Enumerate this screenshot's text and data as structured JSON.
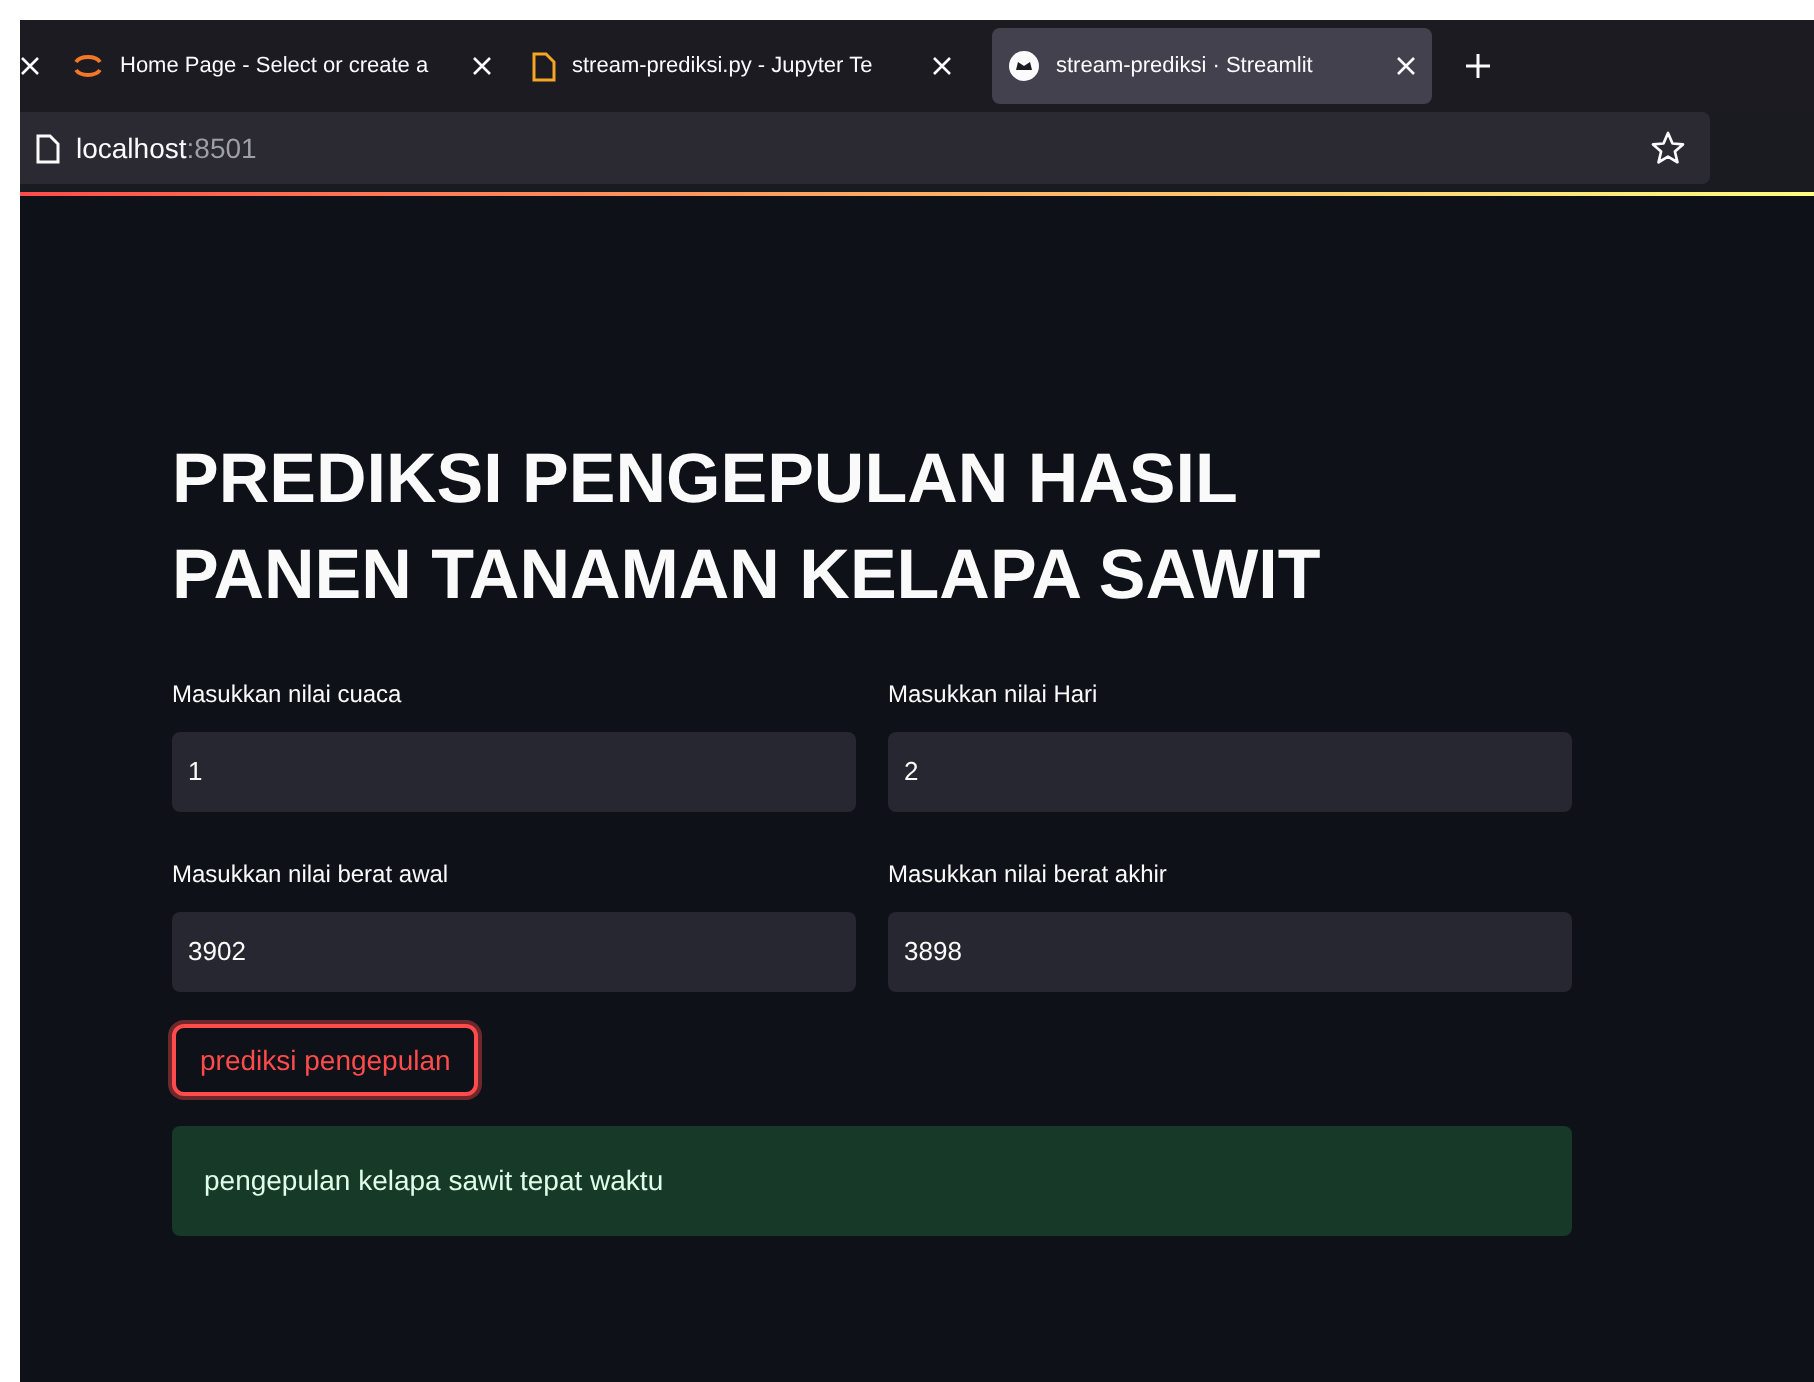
{
  "browser": {
    "tabs": [
      {
        "kind": "cut"
      },
      {
        "title": "Home Page - Select or create a",
        "selected": false,
        "kind": "jupyter"
      },
      {
        "title": "stream-prediksi.py - Jupyter Te",
        "selected": false,
        "kind": "file"
      },
      {
        "title": "stream-prediksi · Streamlit",
        "selected": true,
        "kind": "streamlit"
      }
    ],
    "address": {
      "host": "localhost",
      "port": ":8501"
    }
  },
  "page": {
    "title": "PREDIKSI PENGEPULAN HASIL PANEN TANAMAN KELAPA SAWIT",
    "fields": [
      {
        "label": "Masukkan nilai cuaca",
        "value": "1"
      },
      {
        "label": "Masukkan nilai Hari",
        "value": "2"
      },
      {
        "label": "Masukkan nilai berat awal",
        "value": "3902"
      },
      {
        "label": "Masukkan nilai berat akhir",
        "value": "3898"
      }
    ],
    "button": "prediksi pengepulan",
    "result": "pengepulan kelapa sawit tepat waktu"
  }
}
